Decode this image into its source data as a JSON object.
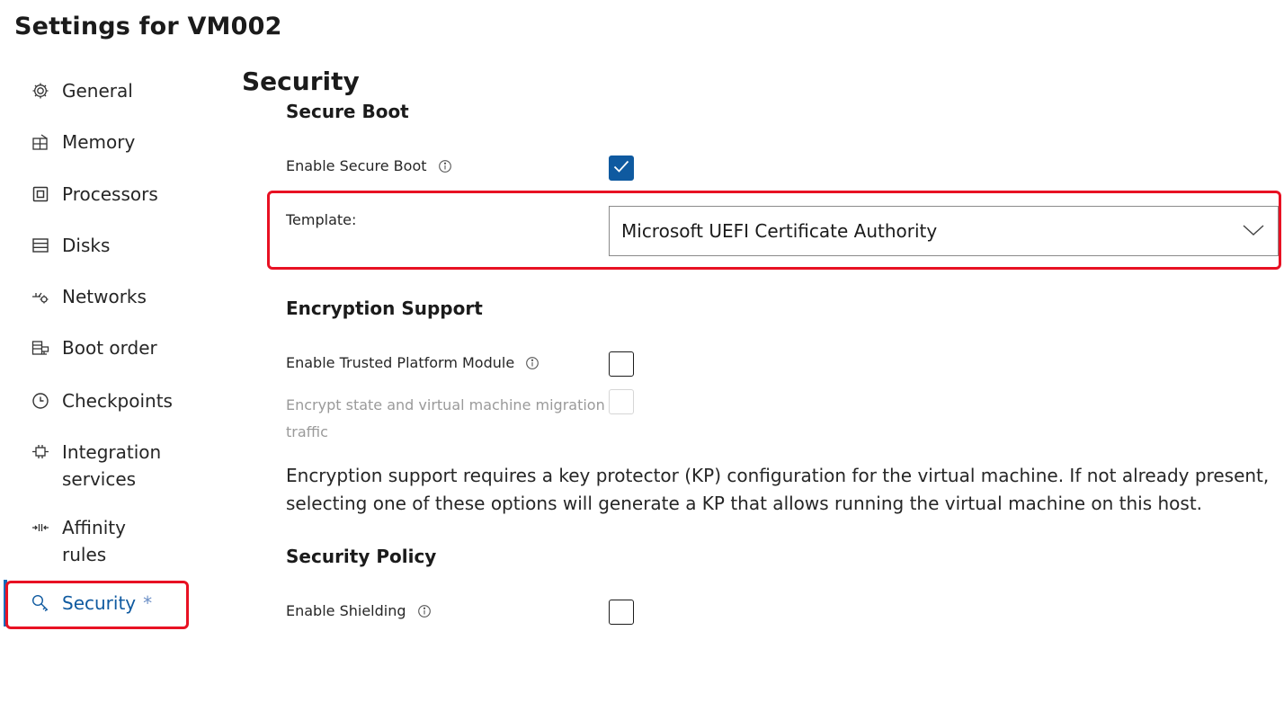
{
  "page": {
    "title": "Settings for VM002"
  },
  "sidebar": {
    "items": [
      {
        "label": "General",
        "icon": "gear-icon"
      },
      {
        "label": "Memory",
        "icon": "memory-icon"
      },
      {
        "label": "Processors",
        "icon": "processor-icon"
      },
      {
        "label": "Disks",
        "icon": "disk-icon"
      },
      {
        "label": "Networks",
        "icon": "network-icon"
      },
      {
        "label": "Boot order",
        "icon": "boot-order-icon"
      },
      {
        "label": "Checkpoints",
        "icon": "clock-icon"
      },
      {
        "label": "Integration services",
        "icon": "integration-icon"
      },
      {
        "label": "Affinity rules",
        "icon": "affinity-icon"
      },
      {
        "label": "Security",
        "icon": "key-icon",
        "active": true,
        "modified_mark": "*"
      }
    ],
    "active_color": "#0f5aa0"
  },
  "security": {
    "title": "Security",
    "secure_boot": {
      "heading": "Secure Boot",
      "enable_label": "Enable Secure Boot",
      "enable_checked": true,
      "template_label": "Template:",
      "template_value": "Microsoft UEFI Certificate Authority"
    },
    "encryption": {
      "heading": "Encryption Support",
      "tpm_label": "Enable Trusted Platform Module",
      "tpm_checked": false,
      "encrypt_label_line1": "Encrypt state and virtual machine migration",
      "encrypt_label_line2": "traffic",
      "encrypt_checked": false,
      "encrypt_disabled": true,
      "description": "Encryption support requires a key protector (KP) configuration for the virtual machine. If not already present, selecting one of these options will generate a KP that allows running the virtual machine on this host."
    },
    "policy": {
      "heading": "Security Policy",
      "shielding_label": "Enable Shielding",
      "shielding_checked": false
    }
  },
  "colors": {
    "accent": "#0f5aa0",
    "highlight": "#e81123"
  }
}
